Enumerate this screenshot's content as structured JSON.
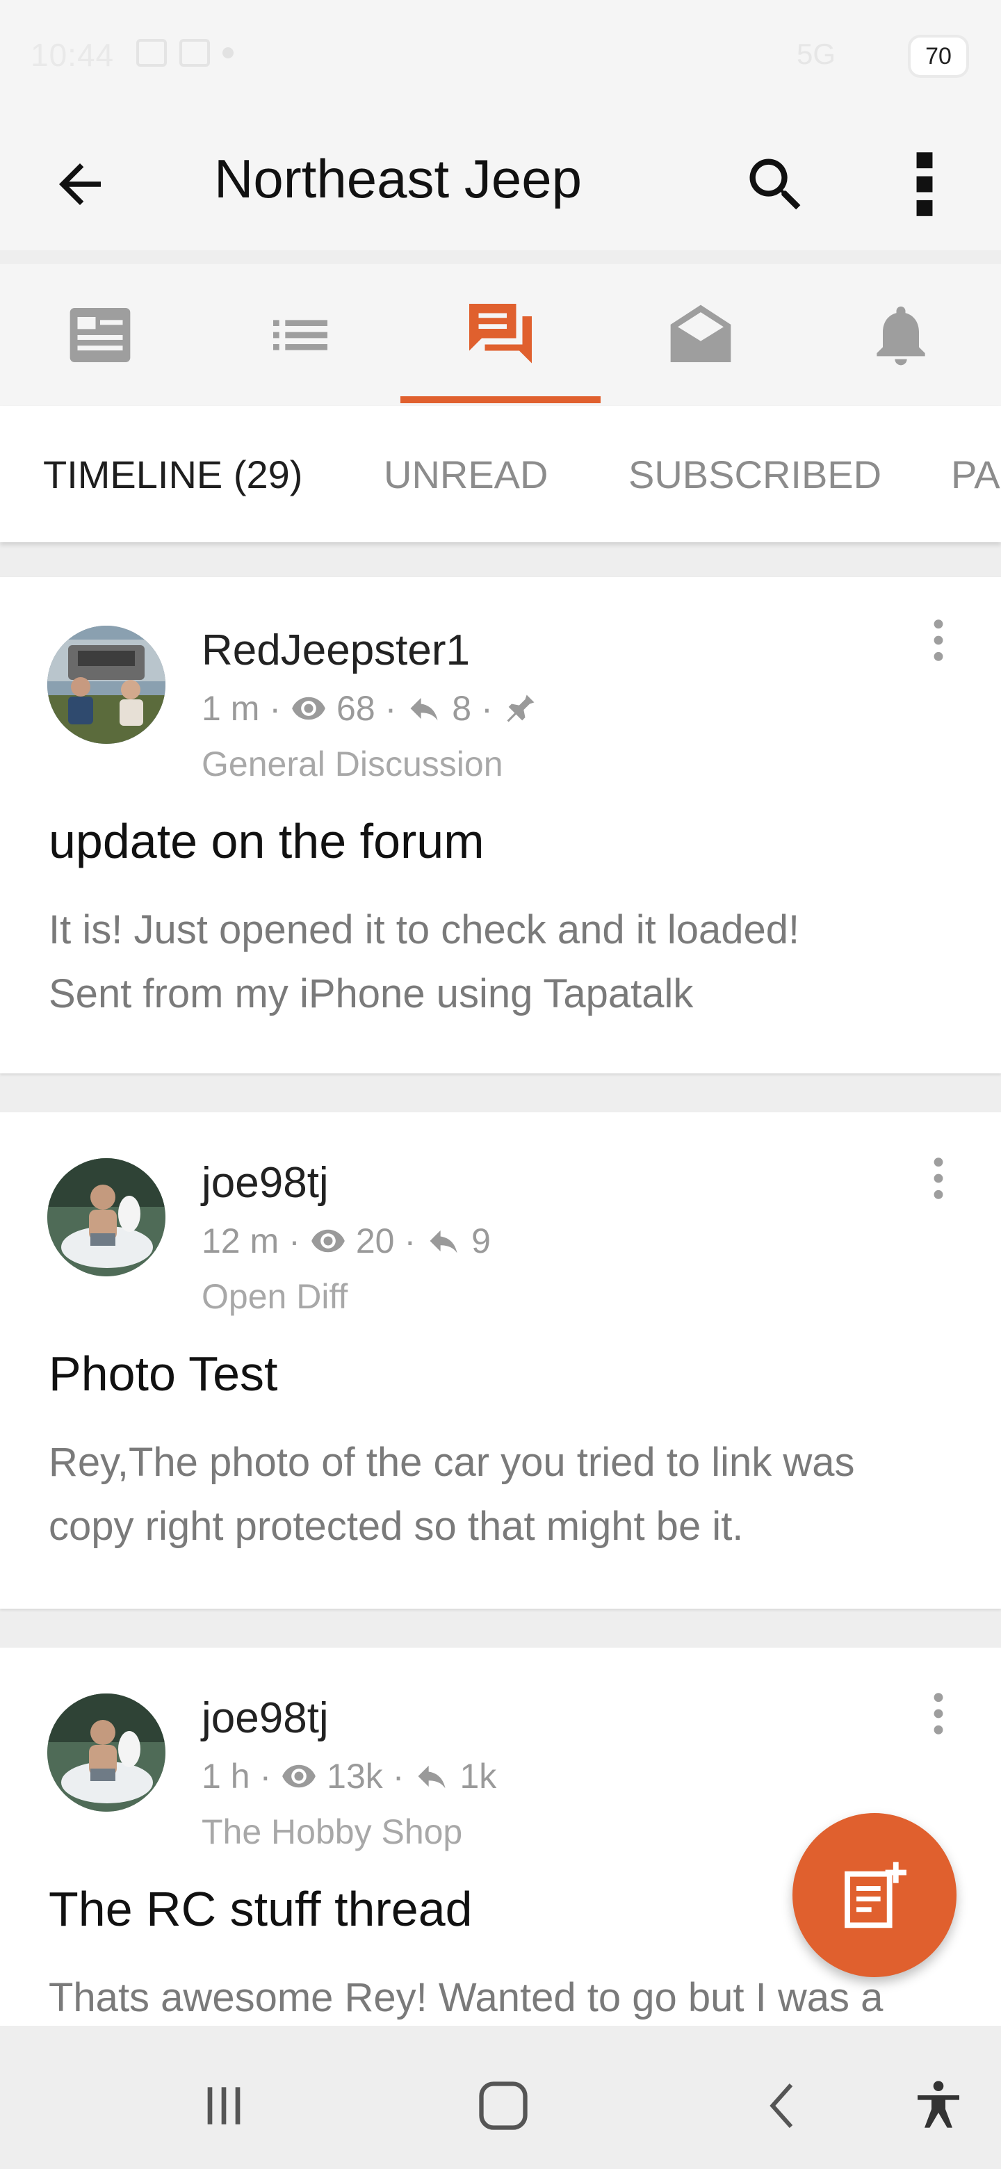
{
  "status": {
    "time": "10:44",
    "network": "5G",
    "battery": "70"
  },
  "header": {
    "title": "Northeast Jeep"
  },
  "icons": {
    "back": "arrow-left-icon",
    "search": "search-icon",
    "more": "more-vert-icon",
    "tabs": [
      "feed-icon",
      "list-icon",
      "forum-icon",
      "inbox-icon",
      "bell-icon"
    ]
  },
  "subtabs": [
    "TIMELINE (29)",
    "UNREAD",
    "SUBSCRIBED",
    "PA"
  ],
  "posts": [
    {
      "author": "RedJeepster1",
      "time": "1 m",
      "views": "68",
      "replies": "8",
      "pinned": true,
      "forum": "General Discussion",
      "title": "update on the forum",
      "preview_line1": "It is! Just opened it to check and it loaded!",
      "preview_line2": "Sent from my iPhone using Tapatalk"
    },
    {
      "author": "joe98tj",
      "time": "12 m",
      "views": "20",
      "replies": "9",
      "pinned": false,
      "forum": "Open Diff",
      "title": "Photo Test",
      "preview_line1": "Rey,The photo of the car you tried to link was",
      "preview_line2": "copy right protected so that might be it."
    },
    {
      "author": "joe98tj",
      "time": "1 h",
      "views": "13k",
      "replies": "1k",
      "pinned": false,
      "forum": "The Hobby Shop",
      "title": "The RC stuff thread",
      "preview_line1": "Thats awesome Rey! Wanted to go but I was a",
      "preview_line2": ""
    }
  ],
  "colors": {
    "accent": "#e0602e",
    "icon_grey": "#9e9e9e"
  }
}
